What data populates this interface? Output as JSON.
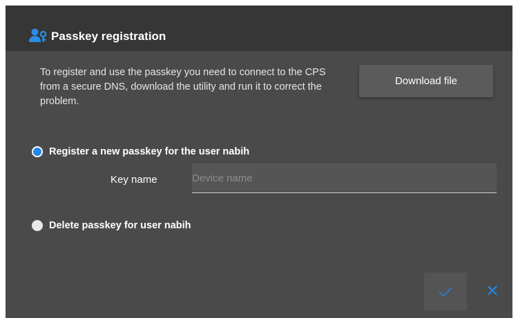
{
  "dialog": {
    "title": "Passkey registration",
    "title_icon": "user-key-icon",
    "info_text": "To register and use the passkey you need to connect to the CPS from a secure DNS, download the utility and run it to correct the problem.",
    "download_button_label": "Download file",
    "options": [
      {
        "label": "Register a new passkey for the user nabih",
        "selected": true
      },
      {
        "label": "Delete passkey for user nabih",
        "selected": false
      }
    ],
    "key_name_label": "Key name",
    "key_name_value": "",
    "key_name_placeholder": "Device name",
    "confirm_icon": "check-icon",
    "close_icon": "close-icon"
  },
  "colors": {
    "titlebar_bg": "#363636",
    "dialog_bg": "#4a4a4a",
    "accent": "#1f88e8",
    "text": "#ffffff"
  }
}
